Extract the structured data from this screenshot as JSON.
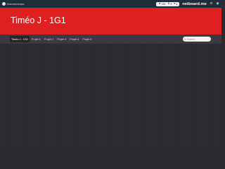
{
  "topbar": {
    "user_name": "timeodevanspa",
    "stats": [
      {
        "icon": "star-icon",
        "glyph": "★",
        "value": "190"
      },
      {
        "icon": "download-icon",
        "glyph": "⬇",
        "value": "9"
      },
      {
        "icon": "heart-icon",
        "glyph": "♥",
        "value": "4"
      }
    ],
    "logo": "netboard.me",
    "icons": [
      "settings-icon",
      "user-circle-icon"
    ]
  },
  "hero": {
    "title": "Timéo J - 1G1",
    "background": "#df2020"
  },
  "tabs": [
    {
      "label": "Timéo J - 1G1",
      "active": true
    },
    {
      "label": "Projet 1",
      "active": false
    },
    {
      "label": "Projet 2",
      "active": false
    },
    {
      "label": "Projet 3",
      "active": false
    },
    {
      "label": "Projet 4",
      "active": false
    },
    {
      "label": "Projet 5",
      "active": false
    }
  ],
  "search": {
    "placeholder": "Search",
    "value": ""
  },
  "colors": {
    "topbar": "#1f2c3a",
    "accent": "#df2020",
    "tabbar": "#3b3a42",
    "content": "#2b2a30"
  }
}
